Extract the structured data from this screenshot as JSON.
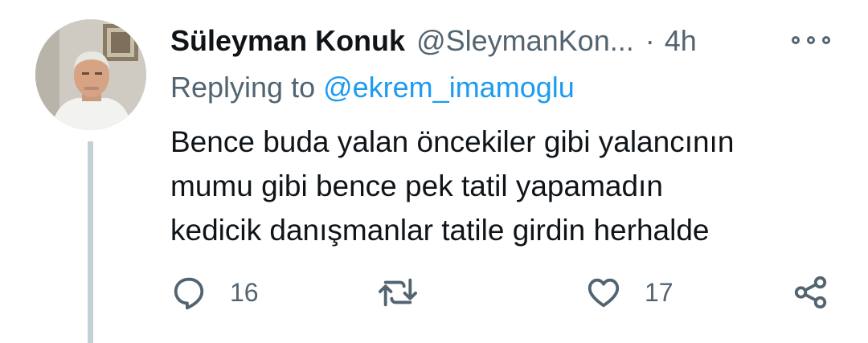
{
  "tweet": {
    "display_name": "Süleyman Konuk",
    "handle": "@SleymanKon...",
    "separator": "·",
    "time": "4h",
    "replying_prefix": "Replying to ",
    "replying_to": "@ekrem_imamoglu",
    "body_lines": [
      "Bence buda yalan öncekiler gibi yalancının",
      "mumu gibi bence pek tatil yapamadın",
      "kedicik danışmanlar tatile girdin herhalde"
    ],
    "reply_count": "16",
    "retweet_count": "",
    "like_count": "17"
  },
  "icons": {
    "more": "more-icon",
    "reply": "reply-icon",
    "retweet": "retweet-icon",
    "like": "heart-icon",
    "share": "share-icon"
  },
  "colors": {
    "text_primary": "#0f1419",
    "text_secondary": "#536471",
    "mention": "#1d9bf0",
    "thread_line": "#c4cfd6"
  }
}
